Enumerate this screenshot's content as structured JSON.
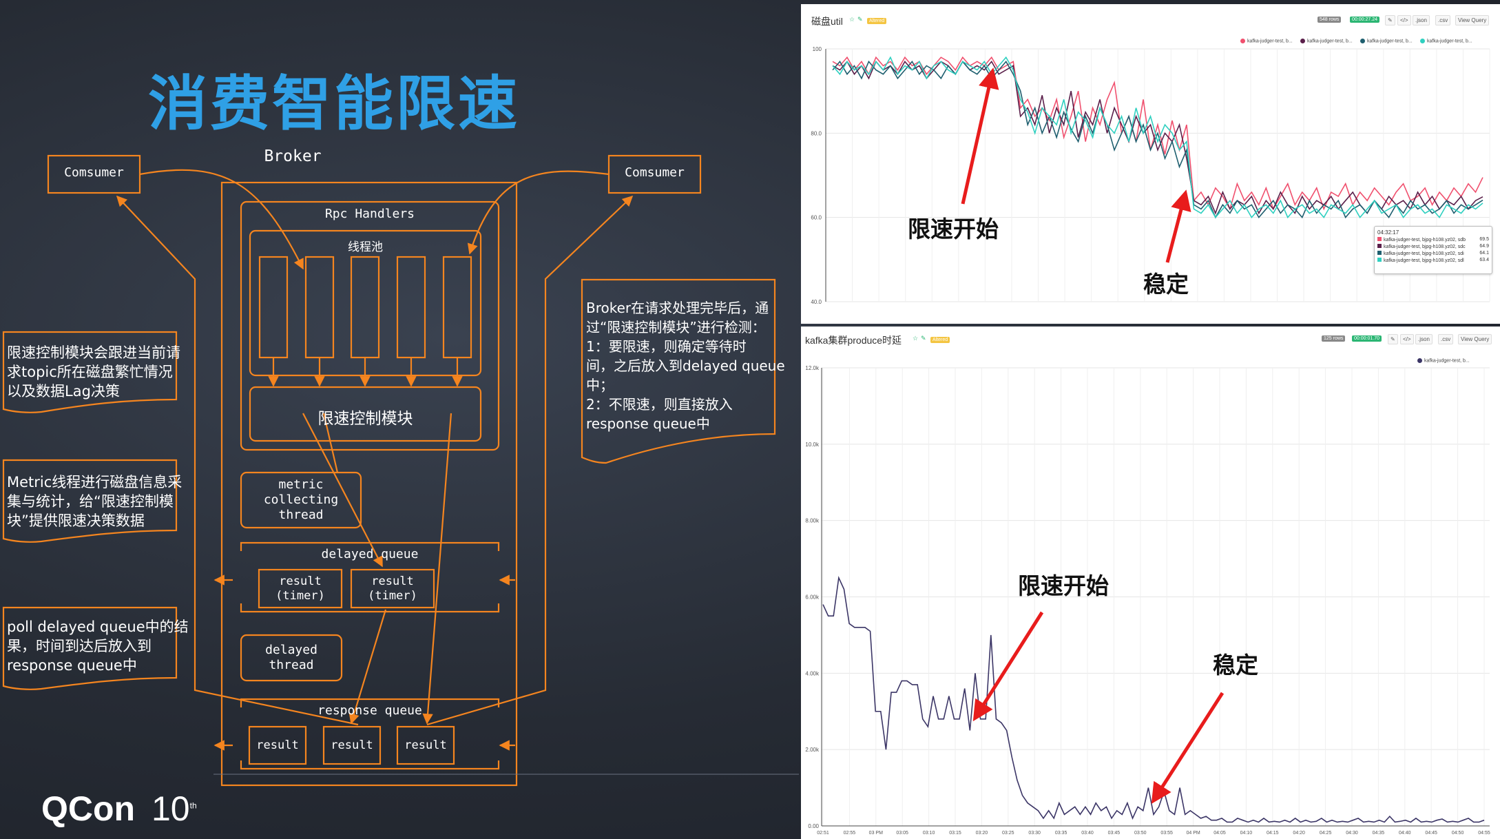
{
  "slide": {
    "title": "消费智能限速",
    "logo_text": "QCon",
    "logo_suffix": "10",
    "logo_sup": "th"
  },
  "diagram": {
    "broker_label": "Broker",
    "consumer_left": "Comsumer",
    "consumer_right": "Comsumer",
    "rpc_handlers": "Rpc Handlers",
    "thread_pool": "线程池",
    "rate_limit_module": "限速控制模块",
    "metric_thread": "metric\ncollecting\nthread",
    "delayed_queue": "delayed queue",
    "delayed_result_1": "result\n(timer)",
    "delayed_result_2": "result\n(timer)",
    "delayed_thread": "delayed\nthread",
    "response_queue": "response queue",
    "response_results": [
      "result",
      "result",
      "result"
    ],
    "note_left_1": [
      "限速控制模块会跟进当前请",
      "求topic所在磁盘繁忙情况",
      "以及数据Lag决策"
    ],
    "note_left_2": [
      "Metric线程进行磁盘信息采",
      "集与统计，给“限速控制模",
      "块”提供限速决策数据"
    ],
    "note_left_3": [
      "poll delayed queue中的结",
      "果，时间到达后放入到",
      "response queue中"
    ],
    "note_right": [
      "Broker在请求处理完毕后，通",
      "过“限速控制模块”进行检测：",
      "1：要限速，则确定等待时",
      "间，之后放入到delayed queue",
      "中；",
      "2：不限速，则直接放入",
      "response queue中"
    ]
  },
  "panels": {
    "top": {
      "title": "磁盘util",
      "tag": "Altered",
      "rows_badge": "548 rows",
      "time_badge": "00:00:27.24",
      "buttons": [
        ".json",
        ".csv",
        "View Query"
      ],
      "legend": [
        "kafka-judger-test, b...",
        "kafka-judger-test, b...",
        "kafka-judger-test, b...",
        "kafka-judger-test, b..."
      ],
      "tooltip_time": "04:32:17",
      "tooltip_rows": [
        {
          "label": "kafka-judger-test, bjpg-h108.yz02, sdb",
          "value": "69.5"
        },
        {
          "label": "kafka-judger-test, bjpg-h108.yz02, sdc",
          "value": "64.9"
        },
        {
          "label": "kafka-judger-test, bjpg-h108.yz02, sdi",
          "value": "64.1"
        },
        {
          "label": "kafka-judger-test, bjpg-h108.yz02, sdl",
          "value": "63.4"
        }
      ],
      "annot_start": "限速开始",
      "annot_stable": "稳定"
    },
    "bottom": {
      "title": "kafka集群produce时延",
      "tag": "Altered",
      "rows_badge": "125 rows",
      "time_badge": "00:00:01.70",
      "buttons": [
        ".json",
        ".csv",
        "View Query"
      ],
      "legend": [
        "kafka-judger-test, b..."
      ],
      "annot_start": "限速开始",
      "annot_stable": "稳定"
    }
  },
  "colors": {
    "orange": "#f5851f",
    "title_blue": "#2fa0e6",
    "series": [
      "#f0506e",
      "#5a1f4a",
      "#1f5f6f",
      "#2fd0c0"
    ],
    "bottom_series": "#3b3566",
    "arrow_red": "#e81c1c"
  },
  "chart_data": [
    {
      "type": "line",
      "title": "磁盘util",
      "ylim": [
        40,
        100
      ],
      "yticks": [
        "100",
        "80.0",
        "60.0",
        "40.0"
      ],
      "grid": true,
      "legend_position": "top-right",
      "series": [
        {
          "name": "kafka-judger-test, bjpg-h108.yz02, sdb",
          "values": [
            97,
            96,
            98,
            95,
            97,
            94,
            98,
            96,
            97,
            95,
            98,
            96,
            97,
            94,
            96,
            98,
            97,
            95,
            98,
            96,
            97,
            96,
            98,
            95,
            96,
            97,
            86,
            88,
            84,
            86,
            83,
            88,
            79,
            84,
            90,
            78,
            86,
            82,
            88,
            92,
            80,
            84,
            78,
            88,
            76,
            82,
            75,
            83,
            76,
            82,
            64,
            66,
            63,
            67,
            65,
            62,
            68,
            64,
            66,
            63,
            67,
            62,
            65,
            68,
            63,
            66,
            64,
            67,
            62,
            66,
            65,
            68,
            63,
            66,
            64,
            67,
            65,
            63,
            66,
            68,
            64,
            65,
            67,
            63,
            66,
            64,
            67,
            65,
            68,
            66,
            69.5
          ]
        },
        {
          "name": "kafka-judger-test, bjpg-h108.yz02, sdc",
          "values": [
            96,
            95,
            97,
            94,
            96,
            93,
            97,
            95,
            96,
            94,
            97,
            95,
            96,
            93,
            95,
            97,
            96,
            94,
            97,
            95,
            96,
            95,
            97,
            94,
            95,
            96,
            84,
            86,
            82,
            89,
            80,
            86,
            82,
            90,
            79,
            85,
            82,
            88,
            80,
            86,
            82,
            78,
            84,
            80,
            82,
            76,
            80,
            78,
            82,
            74,
            64,
            63,
            65,
            61,
            66,
            62,
            64,
            63,
            65,
            61,
            64,
            62,
            66,
            63,
            61,
            65,
            62,
            64,
            63,
            65,
            62,
            64,
            66,
            63,
            61,
            64,
            62,
            65,
            63,
            64,
            62,
            66,
            63,
            65,
            62,
            64,
            63,
            65,
            62,
            64,
            64.9
          ]
        },
        {
          "name": "kafka-judger-test, bjpg-h108.yz02, sdi",
          "values": [
            95,
            97,
            94,
            96,
            93,
            97,
            95,
            94,
            96,
            93,
            95,
            97,
            94,
            96,
            95,
            93,
            96,
            94,
            97,
            95,
            94,
            96,
            93,
            95,
            97,
            94,
            90,
            82,
            86,
            80,
            84,
            79,
            85,
            81,
            78,
            84,
            80,
            86,
            82,
            76,
            80,
            84,
            78,
            82,
            76,
            80,
            74,
            78,
            72,
            76,
            63,
            62,
            64,
            60,
            63,
            61,
            64,
            62,
            63,
            60,
            62,
            64,
            61,
            63,
            62,
            60,
            64,
            61,
            63,
            62,
            64,
            60,
            62,
            63,
            61,
            64,
            62,
            60,
            63,
            61,
            64,
            62,
            63,
            61,
            62,
            64,
            61,
            63,
            62,
            63,
            64.1
          ]
        },
        {
          "name": "kafka-judger-test, bjpg-h108.yz02, sdl",
          "values": [
            96,
            94,
            97,
            95,
            96,
            94,
            97,
            95,
            98,
            94,
            96,
            95,
            97,
            93,
            96,
            97,
            95,
            94,
            97,
            96,
            95,
            97,
            94,
            96,
            98,
            95,
            88,
            85,
            80,
            86,
            84,
            82,
            88,
            80,
            85,
            83,
            79,
            86,
            82,
            80,
            84,
            78,
            86,
            80,
            84,
            78,
            82,
            80,
            76,
            78,
            62,
            61,
            63,
            60,
            62,
            64,
            61,
            63,
            60,
            62,
            63,
            61,
            64,
            60,
            62,
            63,
            61,
            62,
            60,
            63,
            62,
            61,
            63,
            60,
            62,
            64,
            61,
            62,
            63,
            60,
            62,
            63,
            61,
            62,
            60,
            63,
            62,
            61,
            63,
            62,
            63.4
          ]
        }
      ]
    },
    {
      "type": "line",
      "title": "kafka集群produce时延",
      "ylim": [
        0,
        12000
      ],
      "yticks": [
        "12.0k",
        "10.0k",
        "8.00k",
        "6.00k",
        "4.00k",
        "2.00k",
        "0.00"
      ],
      "x": [
        "02:51",
        "02:55",
        "03 PM",
        "03:05",
        "03:10",
        "03:15",
        "03:20",
        "03:25",
        "03:30",
        "03:35",
        "03:40",
        "03:45",
        "03:50",
        "03:55",
        "04 PM",
        "04:05",
        "04:10",
        "04:15",
        "04:20",
        "04:25",
        "04:30",
        "04:35",
        "04:40",
        "04:45",
        "04:50",
        "04:55"
      ],
      "grid": true,
      "legend_position": "top-right",
      "series": [
        {
          "name": "kafka-judger-test, b...",
          "values": [
            5800,
            5500,
            5500,
            6500,
            6200,
            5300,
            5200,
            5200,
            5200,
            5100,
            3000,
            3000,
            2000,
            3500,
            3500,
            3800,
            3800,
            3700,
            3700,
            2800,
            2600,
            3400,
            2800,
            2800,
            3400,
            2800,
            2800,
            3600,
            2500,
            4000,
            2800,
            2800,
            5000,
            2800,
            2700,
            2500,
            1800,
            1200,
            800,
            600,
            500,
            400,
            200,
            400,
            200,
            600,
            300,
            400,
            500,
            300,
            500,
            300,
            600,
            400,
            500,
            200,
            400,
            300,
            600,
            200,
            500,
            400,
            1000,
            300,
            500,
            900,
            400,
            300,
            1000,
            300,
            400,
            300,
            200,
            250,
            150,
            150,
            200,
            100,
            100,
            200,
            150,
            100,
            150,
            100,
            200,
            100,
            120,
            100,
            150,
            100,
            200,
            100,
            150,
            100,
            120,
            200,
            100,
            150,
            100,
            120,
            100,
            150,
            200,
            100,
            120,
            100,
            150,
            100,
            250,
            100,
            120,
            150,
            100,
            200,
            100,
            120,
            100,
            150,
            180,
            100,
            120,
            100,
            150,
            200,
            100,
            100,
            150
          ]
        }
      ]
    }
  ]
}
